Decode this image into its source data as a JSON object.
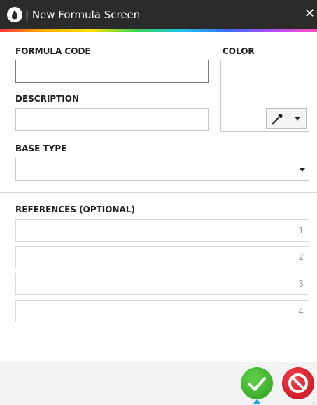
{
  "window": {
    "title": "| New Formula Screen",
    "icon": "water-drop-icon",
    "close_glyph": "✕"
  },
  "form": {
    "formula_code_label": "FORMULA CODE",
    "formula_code_value": "",
    "description_label": "DESCRIPTION",
    "description_value": "",
    "color_label": "COLOR",
    "color_picker_icon": "eyedropper-icon",
    "base_type_label": "BASE TYPE",
    "base_type_value": ""
  },
  "references": {
    "label": "REFERENCES (OPTIONAL)",
    "fields": [
      {
        "index": "1",
        "value": ""
      },
      {
        "index": "2",
        "value": ""
      },
      {
        "index": "3",
        "value": ""
      },
      {
        "index": "4",
        "value": ""
      }
    ]
  },
  "actions": {
    "confirm_icon": "checkmark-icon",
    "cancel_icon": "prohibited-icon"
  },
  "colors": {
    "titlebar": "#2b2b2b",
    "confirm": "#3cb82a",
    "cancel": "#d6212b",
    "accent": "#1fa0e0"
  }
}
